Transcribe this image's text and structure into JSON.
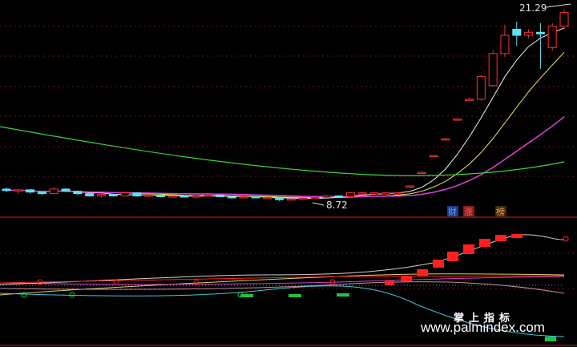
{
  "colors": {
    "background": "#000000",
    "grid": "#8b1a1a",
    "divider": "#b01e1e",
    "candle_up": "#ff3030",
    "candle_down": "#60e0f0",
    "ma_white": "#f0f0f0",
    "ma_yellow": "#e8e858",
    "ma_magenta": "#e040e0",
    "ma_green": "#40d040",
    "osc_red": "#ff2020",
    "osc_magenta": "#d040d0",
    "osc_yellow": "#e0d060",
    "osc_cyan": "#40c8d8",
    "osc_pink": "#c090a0",
    "osc_white": "#d0d0d0"
  },
  "main_panel": {
    "high_label": "21.29",
    "low_label": "8.72",
    "tag_cai": "财",
    "tag_zhang": "涨",
    "tag_bang": "榜"
  },
  "chart_data": {
    "type": "candlestick",
    "title": "",
    "price_high": 21.29,
    "price_low": 8.72,
    "ohlc": [
      [
        9.5,
        9.6,
        9.3,
        9.4
      ],
      [
        9.4,
        9.5,
        9.2,
        9.45
      ],
      [
        9.45,
        9.5,
        9.2,
        9.3
      ],
      [
        9.3,
        9.35,
        9.1,
        9.2
      ],
      [
        9.2,
        9.6,
        9.15,
        9.5
      ],
      [
        9.5,
        9.55,
        9.3,
        9.35
      ],
      [
        9.35,
        9.4,
        9.1,
        9.2
      ],
      [
        9.2,
        9.3,
        9.0,
        9.05
      ],
      [
        9.05,
        9.2,
        8.95,
        9.15
      ],
      [
        9.15,
        9.2,
        9.0,
        9.05
      ],
      [
        9.05,
        9.3,
        9.0,
        9.25
      ],
      [
        9.25,
        9.3,
        9.0,
        9.05
      ],
      [
        9.05,
        9.15,
        8.95,
        9.1
      ],
      [
        9.1,
        9.15,
        8.95,
        9.0
      ],
      [
        9.0,
        9.1,
        8.95,
        9.05
      ],
      [
        9.05,
        9.1,
        8.95,
        9.0
      ],
      [
        9.0,
        9.1,
        8.9,
        9.05
      ],
      [
        9.05,
        9.2,
        9.0,
        9.1
      ],
      [
        9.1,
        9.15,
        8.95,
        9.0
      ],
      [
        9.0,
        9.05,
        8.85,
        8.95
      ],
      [
        8.95,
        9.05,
        8.9,
        9.0
      ],
      [
        9.0,
        9.05,
        8.9,
        8.95
      ],
      [
        8.95,
        9.0,
        8.9,
        8.95
      ],
      [
        8.95,
        8.96,
        8.72,
        8.8
      ],
      [
        8.8,
        8.9,
        8.75,
        8.85
      ],
      [
        8.85,
        8.95,
        8.8,
        8.9
      ],
      [
        8.9,
        9.0,
        8.85,
        8.95
      ],
      [
        8.95,
        9.1,
        8.9,
        9.05
      ],
      [
        9.05,
        9.1,
        8.95,
        9.0
      ],
      [
        9.0,
        9.3,
        8.95,
        9.25
      ],
      [
        9.25,
        9.3,
        9.2,
        9.25
      ],
      [
        9.25,
        9.3,
        9.2,
        9.25
      ],
      [
        9.25,
        9.3,
        9.2,
        9.25
      ],
      [
        9.25,
        9.3,
        9.2,
        9.25
      ],
      [
        9.7,
        9.75,
        9.65,
        9.7
      ],
      [
        10.6,
        10.65,
        10.55,
        10.6
      ],
      [
        11.7,
        11.75,
        11.65,
        11.7
      ],
      [
        12.8,
        12.85,
        12.75,
        12.8
      ],
      [
        14.1,
        14.15,
        14.05,
        14.1
      ],
      [
        15.4,
        15.5,
        15.3,
        15.4
      ],
      [
        15.4,
        17.0,
        15.3,
        16.9
      ],
      [
        16.3,
        18.6,
        16.2,
        18.4
      ],
      [
        18.4,
        20.3,
        18.2,
        19.6
      ],
      [
        20.0,
        20.5,
        18.9,
        19.6
      ],
      [
        19.6,
        20.0,
        19.4,
        19.8
      ],
      [
        19.8,
        20.4,
        17.4,
        19.7
      ],
      [
        18.8,
        20.4,
        18.6,
        20.2
      ],
      [
        20.2,
        21.29,
        20.0,
        21.1
      ]
    ],
    "ma_lines": [
      "white",
      "yellow",
      "magenta",
      "green"
    ],
    "oscillator": {
      "series": [
        "red",
        "magenta",
        "yellow",
        "cyan",
        "pink",
        "white"
      ]
    }
  }
}
